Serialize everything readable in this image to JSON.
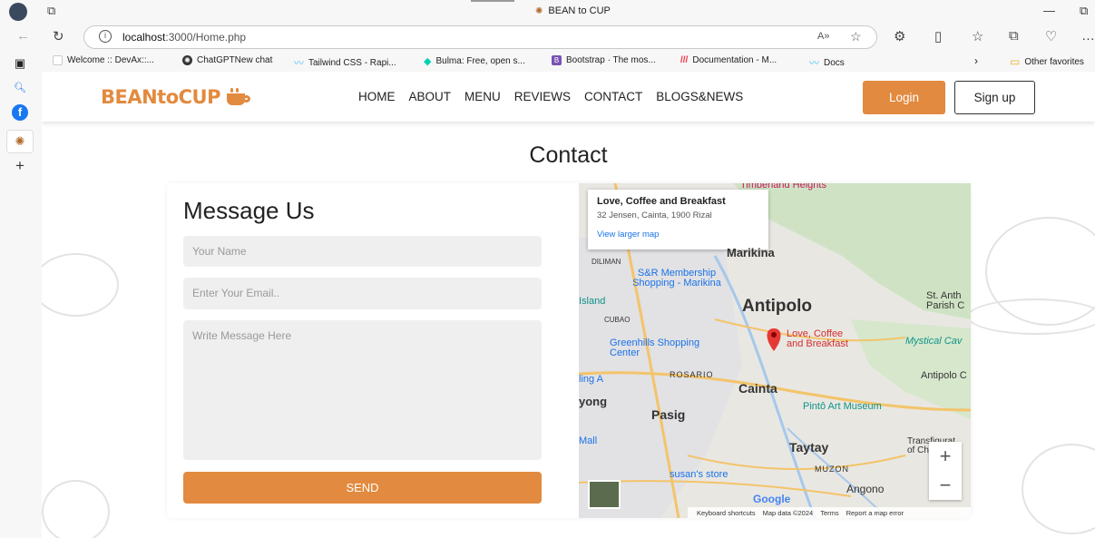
{
  "browser": {
    "tab_title": "BEAN to CUP",
    "url_host": "localhost",
    "url_path": ":3000/Home.php",
    "bookmarks": [
      "Welcome :: DevAx::...",
      "ChatGPTNew chat",
      "Tailwind CSS - Rapi...",
      "Bulma: Free, open s...",
      "Bootstrap · The mos...",
      "Documentation - M...",
      "Docs"
    ],
    "other_favorites": "Other favorites"
  },
  "site": {
    "logo": "BEANtoCUP",
    "menu": [
      "HOME",
      "ABOUT",
      "MENU",
      "REVIEWS",
      "CONTACT",
      "BLOGS&NEWS"
    ],
    "login": "Login",
    "signup": "Sign up"
  },
  "contact": {
    "section_title": "Contact",
    "form_title": "Message Us",
    "name_placeholder": "Your Name",
    "email_placeholder": "Enter Your Email..",
    "message_placeholder": "Write Message Here",
    "send": "SEND"
  },
  "map": {
    "popup_title": "Love, Coffee and Breakfast",
    "popup_address": "32 Jensen, Cainta, 1900 Rizal",
    "popup_link": "View larger map",
    "labels": {
      "timberland": "Timberland Heights",
      "marikina": "Marikina",
      "diliman": "DILIMAN",
      "sr": "S&R Membership Shopping - Marikina",
      "island": "Island",
      "cubao": "CUBAO",
      "antipolo": "Antipolo",
      "stanth": "St. Anth Parish C",
      "love": "Love, Coffee and Breakfast",
      "greenhills": "Greenhills Shopping Center",
      "mystical": "Mystical Cav",
      "rosario": "ROSARIO",
      "ling": "ling A",
      "antipolo_c": "Antipolo C",
      "cainta": "Cainta",
      "yong": "yong",
      "pasig": "Pasig",
      "pinto": "Pintô Art Museum",
      "mall": "Mall",
      "taytay": "Taytay",
      "transfig": "Transfigurat of Ch",
      "susan": "susan's store",
      "muzon": "MUZON",
      "angono": "Angono"
    },
    "zoom_in": "+",
    "zoom_out": "−",
    "google": "Google",
    "attrib": [
      "Keyboard shortcuts",
      "Map data ©2024",
      "Terms",
      "Report a map error"
    ]
  }
}
